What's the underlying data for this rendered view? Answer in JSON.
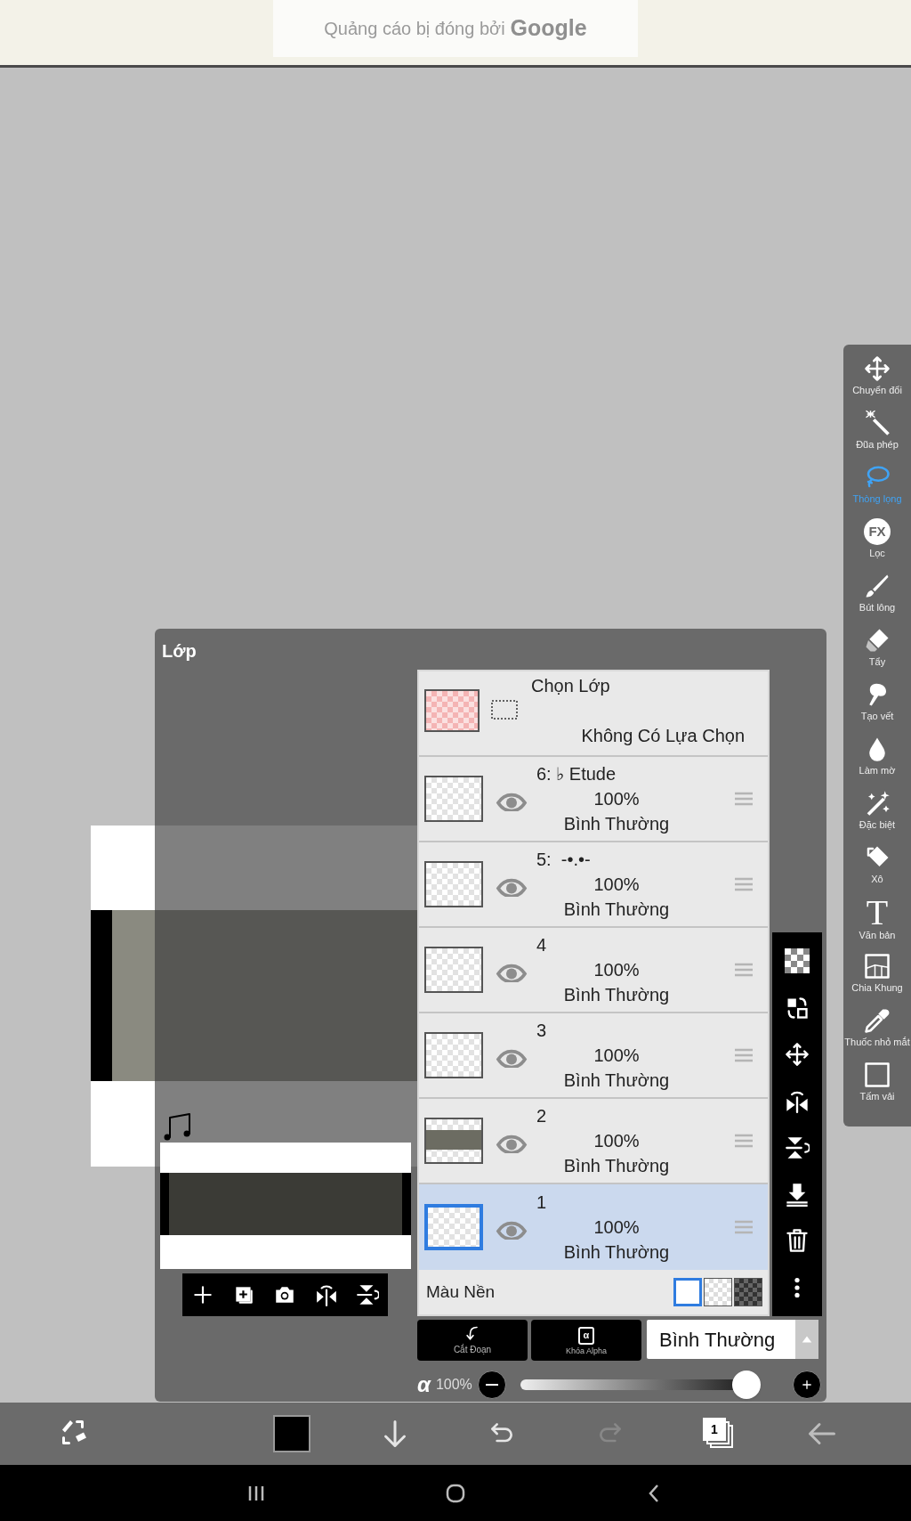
{
  "ad_banner": {
    "text": "Quảng cáo bị đóng bởi",
    "brand": "Google"
  },
  "toolbar": [
    {
      "kind": "transform",
      "label": "Chuyển đổi",
      "selected": false
    },
    {
      "kind": "wand",
      "label": "Đũa phép",
      "selected": false
    },
    {
      "kind": "lasso",
      "label": "Thòng lọng",
      "selected": true
    },
    {
      "kind": "fx",
      "icon_text": "FX",
      "label": "Lọc",
      "selected": false
    },
    {
      "kind": "brush",
      "label": "Bút lông",
      "selected": false
    },
    {
      "kind": "eraser",
      "label": "Tẩy",
      "selected": false
    },
    {
      "kind": "smudge",
      "label": "Tạo vết",
      "selected": false
    },
    {
      "kind": "blur",
      "label": "Làm mờ",
      "selected": false
    },
    {
      "kind": "special",
      "label": "Đặc biệt",
      "selected": false
    },
    {
      "kind": "bucket",
      "label": "Xô",
      "selected": false
    },
    {
      "kind": "text",
      "icon_text": "T",
      "label": "Văn bản",
      "selected": false
    },
    {
      "kind": "frame",
      "label": "Chia Khung",
      "selected": false
    },
    {
      "kind": "dropper",
      "label": "Thuốc nhỏ mắt",
      "selected": false
    },
    {
      "kind": "canvas",
      "label": "Tấm vải",
      "selected": false
    }
  ],
  "layers_panel": {
    "title": "Lớp",
    "selection_layer": {
      "title": "Chọn Lớp",
      "status": "Không Có Lựa Chọn"
    },
    "layers": [
      {
        "name": "6: ♭ Etude",
        "opacity": "100%",
        "blend": "Bình Thường",
        "visible": true,
        "selected": false,
        "kind": "blank"
      },
      {
        "name": "5:  -•.•-",
        "opacity": "100%",
        "blend": "Bình Thường",
        "visible": true,
        "selected": false,
        "kind": "blank"
      },
      {
        "name": "4",
        "opacity": "100%",
        "blend": "Bình Thường",
        "visible": true,
        "selected": false,
        "kind": "blank"
      },
      {
        "name": "3",
        "opacity": "100%",
        "blend": "Bình Thường",
        "visible": true,
        "selected": false,
        "kind": "blank"
      },
      {
        "name": "2",
        "opacity": "100%",
        "blend": "Bình Thường",
        "visible": true,
        "selected": false,
        "kind": "photo"
      },
      {
        "name": "1",
        "opacity": "100%",
        "blend": "Bình Thường",
        "visible": true,
        "selected": true,
        "kind": "blank"
      }
    ],
    "background": {
      "label": "Màu Nền",
      "options": [
        {
          "kind": "white",
          "selected": true
        },
        {
          "kind": "transparent",
          "selected": false
        },
        {
          "kind": "dark",
          "selected": false
        }
      ]
    },
    "clipping_button": "Cắt Đoạn",
    "alpha_lock_button": "Khóa Alpha",
    "alpha_lock_icon_text": "α",
    "blend_mode": "Bình Thường",
    "opacity": {
      "symbol": "α",
      "reading": "100%",
      "level": 1
    }
  },
  "bottom_bar": {
    "color": "#000000",
    "layer_count": "1",
    "redo_disabled": true
  }
}
